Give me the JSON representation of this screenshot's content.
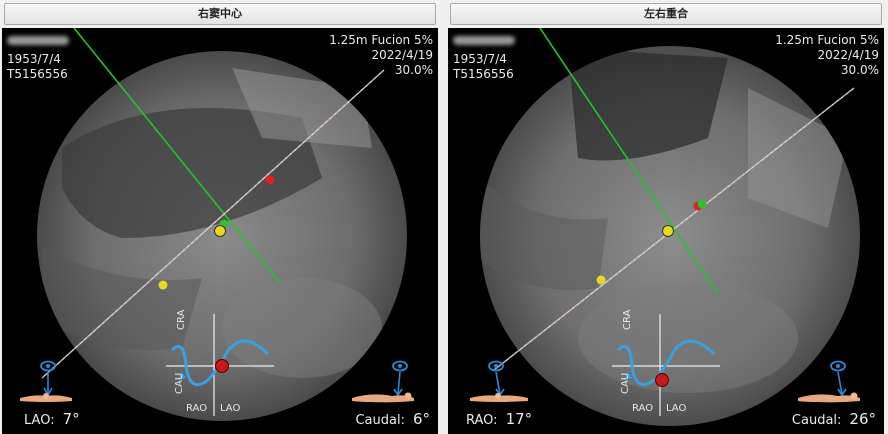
{
  "panels": [
    {
      "title": "右窦中心",
      "patient": {
        "birth_date": "1953/7/4",
        "id": "T5156556"
      },
      "series": "1.25m Fucion 5%",
      "date": "2022/4/19",
      "zoom": "30.0%",
      "angle1": {
        "label": "LAO:",
        "value": "7°"
      },
      "angle2": {
        "label": "Caudal:",
        "value": "6°"
      },
      "gizmo": {
        "cra": "CRA",
        "cau": "CAU",
        "rao": "RAO",
        "lao": "LAO"
      }
    },
    {
      "title": "左右重合",
      "patient": {
        "birth_date": "1953/7/4",
        "id": "T5156556"
      },
      "series": "1.25m Fucion 5%",
      "date": "2022/4/19",
      "zoom": "30.0%",
      "angle1": {
        "label": "RAO:",
        "value": "17°"
      },
      "angle2": {
        "label": "Caudal:",
        "value": "26°"
      },
      "gizmo": {
        "cra": "CRA",
        "cau": "CAU",
        "rao": "RAO",
        "lao": "LAO"
      }
    }
  ],
  "colors": {
    "valve_line": "#d8d8d8",
    "centerline": "#22c42a",
    "marker_red": "#e02020",
    "marker_yellow": "#e8d820",
    "marker_green": "#30c030",
    "gizmo_curve": "#3aa0e0",
    "gizmo_dot": "#c81818",
    "eye_icon": "#2a8ad8"
  },
  "icons": [
    "eye-icon",
    "patient-body-icon"
  ]
}
